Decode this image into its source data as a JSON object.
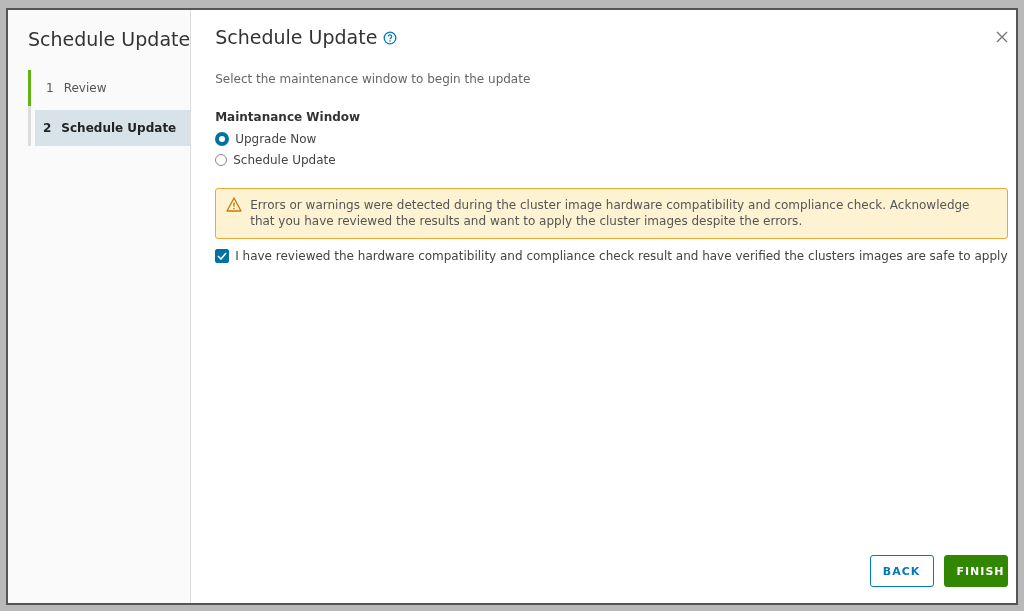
{
  "sidebar": {
    "title": "Schedule Update",
    "steps": [
      {
        "number": "1",
        "label": "Review",
        "selected": false,
        "completed": true
      },
      {
        "number": "2",
        "label": "Schedule Update",
        "selected": true,
        "completed": false
      }
    ]
  },
  "main": {
    "title": "Schedule Update",
    "subtitle": "Select the maintenance window to begin the update",
    "group_label": "Maintanance Window",
    "options": [
      {
        "label": "Upgrade Now",
        "selected": true
      },
      {
        "label": "Schedule Update",
        "selected": false
      }
    ],
    "alert": {
      "text": "Errors or warnings were detected during the cluster image hardware compatibility and compliance check. Acknowledge that you have reviewed the results and want to apply the cluster images despite the errors."
    },
    "acknowledge": {
      "label": "I have reviewed the hardware compatibility and compliance check result and have verified the clusters images are safe to apply",
      "checked": true
    }
  },
  "buttons": [
    {
      "label": "BACK",
      "kind": "outline"
    },
    {
      "label": "FINISH",
      "kind": "primary"
    }
  ]
}
